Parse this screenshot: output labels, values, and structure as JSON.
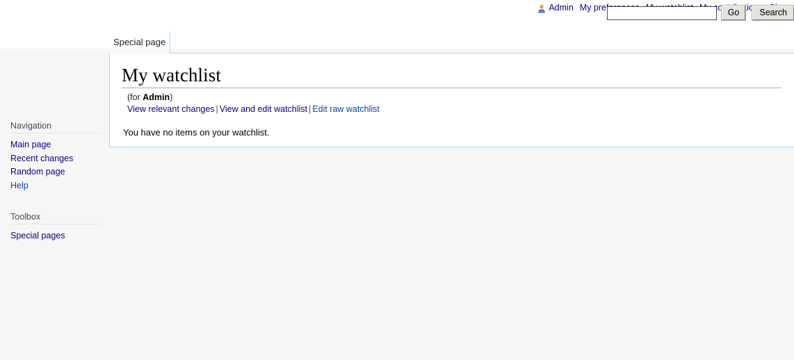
{
  "personal_bar": {
    "user_icon": "user-avatar-icon",
    "items": [
      {
        "label": "Admin",
        "state": "visited"
      },
      {
        "label": "My preferences",
        "state": "visited"
      },
      {
        "label": "My watchlist",
        "state": "visited"
      },
      {
        "label": "My contributions",
        "state": "visited"
      },
      {
        "label": "Close",
        "state": "fresh"
      }
    ]
  },
  "tabs": {
    "active": "Special page"
  },
  "search": {
    "value": "",
    "placeholder": "",
    "go_label": "Go",
    "search_label": "Search"
  },
  "sidebar": {
    "portlets": [
      {
        "heading": "Navigation",
        "items": [
          {
            "label": "Main page",
            "state": "visited"
          },
          {
            "label": "Recent changes",
            "state": "visited"
          },
          {
            "label": "Random page",
            "state": "visited"
          },
          {
            "label": "Help",
            "state": "fresh"
          }
        ]
      },
      {
        "heading": "Toolbox",
        "items": [
          {
            "label": "Special pages",
            "state": "visited"
          }
        ]
      }
    ]
  },
  "content": {
    "title": "My watchlist",
    "subtitle": {
      "prefix": "(for ",
      "user": "Admin",
      "suffix": ")"
    },
    "subtitle_links": [
      {
        "label": "View relevant changes",
        "state": "visited"
      },
      {
        "label": "View and edit watchlist",
        "state": "visited"
      },
      {
        "label": "Edit raw watchlist",
        "state": "fresh"
      }
    ],
    "separator": "|",
    "body": "You have no items on your watchlist."
  },
  "colors": {
    "link_visited": "#0b0080",
    "link_fresh": "#0645ad",
    "border_blue": "#a7d7f9",
    "page_bg": "#f6f6f6",
    "content_bg": "#ffffff"
  }
}
